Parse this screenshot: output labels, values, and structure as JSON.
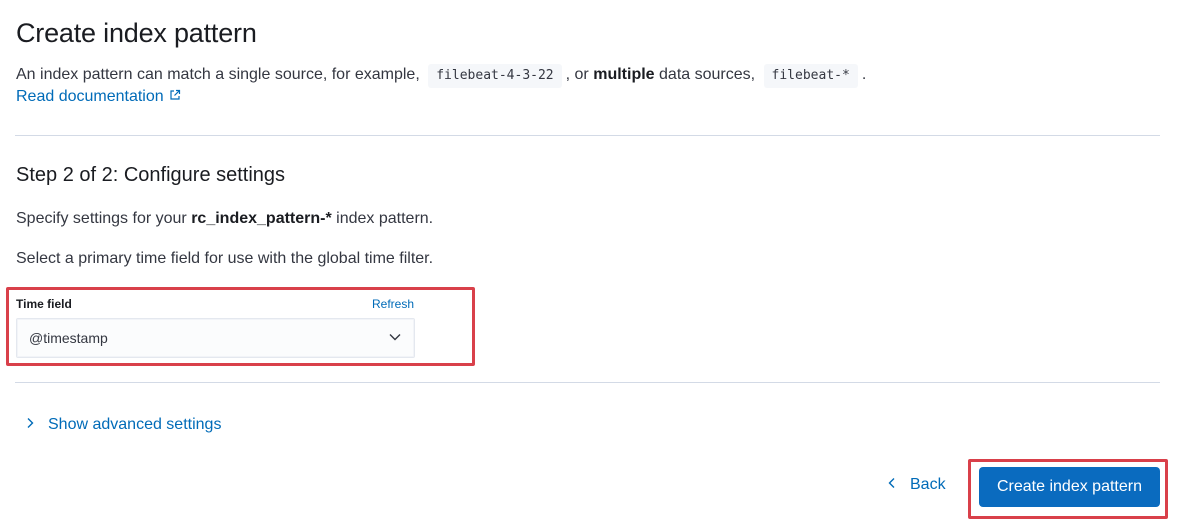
{
  "header": {
    "title": "Create index pattern",
    "desc_prefix": "An index pattern can match a single source, for example,",
    "example_single": "filebeat-4-3-22",
    "desc_middle_1": ", or",
    "desc_bold": "multiple",
    "desc_middle_2": "data sources,",
    "example_multi": "filebeat-*",
    "desc_suffix": ".",
    "doc_link": "Read documentation"
  },
  "step": {
    "title": "Step 2 of 2: Configure settings",
    "specify_prefix": "Specify settings for your",
    "pattern_name": "rc_index_pattern-*",
    "specify_suffix": "index pattern.",
    "time_hint": "Select a primary time field for use with the global time filter."
  },
  "time_field": {
    "label": "Time field",
    "refresh": "Refresh",
    "selected": "@timestamp"
  },
  "advanced": {
    "label": "Show advanced settings"
  },
  "actions": {
    "back": "Back",
    "create": "Create index pattern"
  },
  "colors": {
    "link": "#006bb8",
    "primary": "#0a6bbf",
    "highlight": "#d9404a"
  },
  "icons": {
    "doc_link": "external-link-icon",
    "select": "chevron-down-icon",
    "advanced": "chevron-right-icon",
    "back": "chevron-left-icon"
  }
}
